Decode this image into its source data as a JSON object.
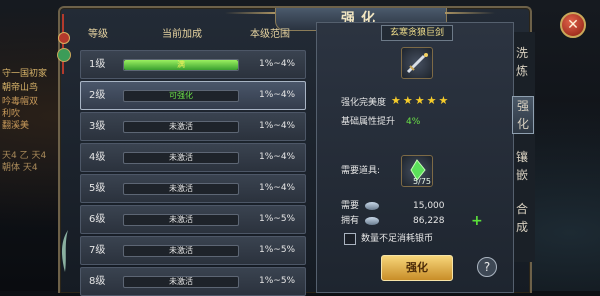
{
  "window": {
    "title": "强化",
    "close_glyph": "✕"
  },
  "background_text": [
    "守一国初家",
    "朝帝山鸟",
    "吟毒帽双",
    "利吹",
    "翻溪美",
    "天4 乙 天4",
    "朝体 天4"
  ],
  "table": {
    "headers": {
      "level": "等级",
      "bonus": "当前加成",
      "range": "本级范围"
    },
    "rows": [
      {
        "level": "1级",
        "status": "满",
        "progress": 1.0,
        "range": "1%~4%",
        "state": "full"
      },
      {
        "level": "2级",
        "status": "可强化",
        "progress": 0,
        "range": "1%~4%",
        "state": "available"
      },
      {
        "level": "3级",
        "status": "未激活",
        "progress": 0,
        "range": "1%~4%",
        "state": "inactive"
      },
      {
        "level": "4级",
        "status": "未激活",
        "progress": 0,
        "range": "1%~4%",
        "state": "inactive"
      },
      {
        "level": "5级",
        "status": "未激活",
        "progress": 0,
        "range": "1%~4%",
        "state": "inactive"
      },
      {
        "level": "6级",
        "status": "未激活",
        "progress": 0,
        "range": "1%~5%",
        "state": "inactive"
      },
      {
        "level": "7级",
        "status": "未激活",
        "progress": 0,
        "range": "1%~5%",
        "state": "inactive"
      },
      {
        "level": "8级",
        "status": "未激活",
        "progress": 0,
        "range": "1%~5%",
        "state": "inactive"
      }
    ],
    "selected_index": 1
  },
  "item": {
    "name": "玄寒贪狼巨剑",
    "perfection_label": "强化完美度",
    "perfection_stars": 5,
    "perfection_max": 5,
    "attr_label": "基础属性提升",
    "attr_value": "4%"
  },
  "material": {
    "label": "需要道具:",
    "count": "5/75"
  },
  "cost": {
    "need_label": "需要",
    "need_value": "15,000",
    "own_label": "拥有",
    "own_value": "86,228",
    "checkbox_label": "数量不足消耗银币",
    "checkbox_checked": false
  },
  "actions": {
    "enhance": "强化",
    "help": "?"
  },
  "side_tabs": [
    {
      "label": "洗炼",
      "active": false
    },
    {
      "label": "强化",
      "active": true
    },
    {
      "label": "镶嵌",
      "active": false
    },
    {
      "label": "合成",
      "active": false
    }
  ],
  "colors": {
    "accent_gold": "#f6cc2a",
    "progress_green": "#6ae046",
    "button": "#e8b450"
  }
}
